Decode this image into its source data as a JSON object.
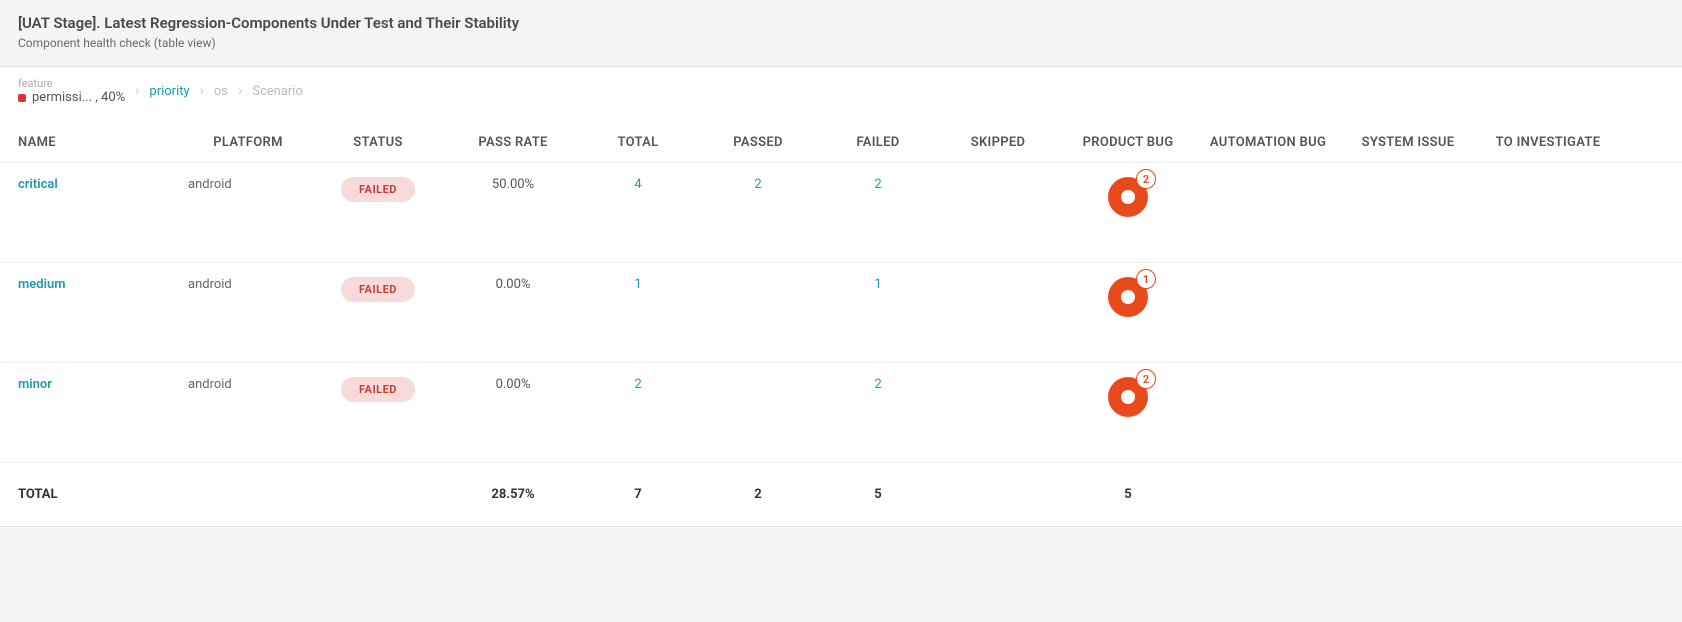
{
  "header": {
    "title": "[UAT Stage]. Latest Regression-Components Under Test and Their Stability",
    "subtitle": "Component health check (table view)"
  },
  "breadcrumb": {
    "feature_label": "feature",
    "feature_value": "permissi... , 40%",
    "items": [
      {
        "label": "priority",
        "active": true
      },
      {
        "label": "os",
        "active": false
      },
      {
        "label": "Scenario",
        "active": false
      }
    ]
  },
  "columns": [
    "NAME",
    "PLATFORM",
    "STATUS",
    "PASS RATE",
    "TOTAL",
    "PASSED",
    "FAILED",
    "SKIPPED",
    "PRODUCT BUG",
    "AUTOMATION BUG",
    "SYSTEM ISSUE",
    "TO INVESTIGATE"
  ],
  "rows": [
    {
      "name": "critical",
      "platform": "android",
      "status": "FAILED",
      "pass_rate": "50.00%",
      "total": "4",
      "passed": "2",
      "failed": "2",
      "skipped": "",
      "product_bug": "2",
      "automation_bug": "",
      "system_issue": "",
      "to_investigate": ""
    },
    {
      "name": "medium",
      "platform": "android",
      "status": "FAILED",
      "pass_rate": "0.00%",
      "total": "1",
      "passed": "",
      "failed": "1",
      "skipped": "",
      "product_bug": "1",
      "automation_bug": "",
      "system_issue": "",
      "to_investigate": ""
    },
    {
      "name": "minor",
      "platform": "android",
      "status": "FAILED",
      "pass_rate": "0.00%",
      "total": "2",
      "passed": "",
      "failed": "2",
      "skipped": "",
      "product_bug": "2",
      "automation_bug": "",
      "system_issue": "",
      "to_investigate": ""
    }
  ],
  "total": {
    "label": "TOTAL",
    "pass_rate": "28.57%",
    "total": "7",
    "passed": "2",
    "failed": "5",
    "skipped": "",
    "product_bug": "5",
    "automation_bug": "",
    "system_issue": "",
    "to_investigate": ""
  }
}
